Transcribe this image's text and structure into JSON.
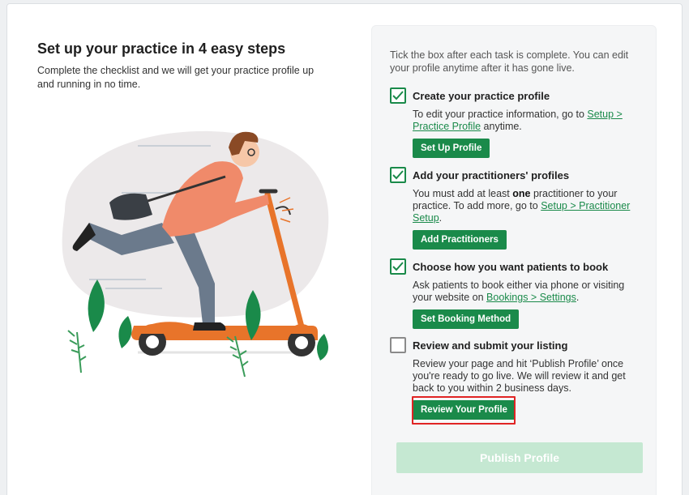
{
  "header": {
    "title": "Set up your practice in 4 easy steps",
    "subtitle": "Complete the checklist and we will get your practice profile up and running in no time."
  },
  "panel": {
    "intro": "Tick the box after each task is complete. You can edit your profile anytime after it has gone live.",
    "steps": [
      {
        "title": "Create your practice profile",
        "checked": true,
        "desc_before": "To edit your practice information, go to ",
        "link": "Setup > Practice Profile",
        "desc_after": " anytime.",
        "button": "Set Up Profile"
      },
      {
        "title": "Add your practitioners' profiles",
        "checked": true,
        "desc_before": "You must add at least ",
        "bold": "one",
        "desc_mid": " practitioner to your practice. To add more, go to ",
        "link": "Setup > Practitioner Setup",
        "desc_after": ".",
        "button": "Add Practitioners"
      },
      {
        "title": "Choose how you want patients to book",
        "checked": true,
        "desc_before": "Ask patients to book either via phone or visiting your website on ",
        "link": "Bookings > Settings",
        "desc_after": ".",
        "button": "Set Booking Method"
      },
      {
        "title": "Review and submit your listing",
        "checked": false,
        "desc_before": "Review your page and hit ‘Publish Profile’ once you're ready to go live. We will review it and get back to you within 2 business days.",
        "button": "Review Your Profile"
      }
    ],
    "publish_button": "Publish Profile"
  },
  "colors": {
    "primary": "#1a8a4a",
    "primary_disabled": "#c5e8d2",
    "highlight": "#e02424",
    "scooter": "#e8742a",
    "shirt": "#f08a6a",
    "pants": "#6b7a8c"
  },
  "icons": {
    "check": "check-icon"
  }
}
